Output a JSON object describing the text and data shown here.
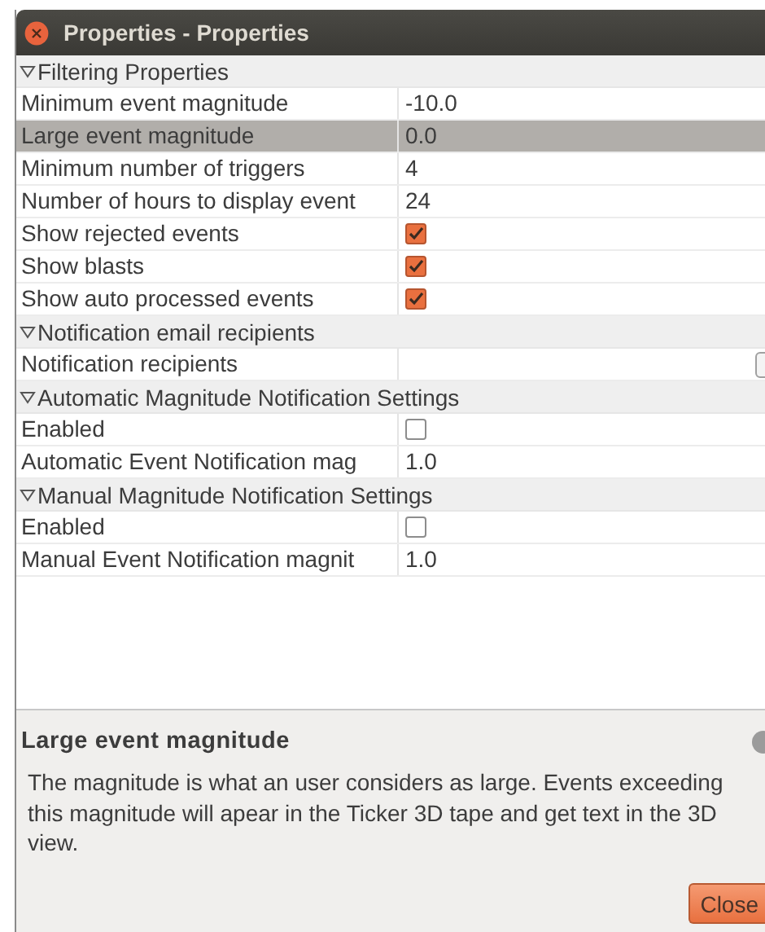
{
  "window": {
    "title": "Properties - Properties"
  },
  "groups": [
    {
      "title": "Filtering Properties",
      "expanded": true,
      "properties": [
        {
          "kind": "text",
          "name": "Minimum event magnitude",
          "value": "-10.0",
          "selected": false
        },
        {
          "kind": "text",
          "name": "Large event magnitude",
          "value": "0.0",
          "selected": true
        },
        {
          "kind": "text",
          "name": "Minimum number of triggers",
          "value": "4",
          "selected": false
        },
        {
          "kind": "text",
          "name": "Number of hours to display event",
          "value": "24",
          "selected": false
        },
        {
          "kind": "check",
          "name": "Show rejected events",
          "checked": true,
          "selected": false
        },
        {
          "kind": "check",
          "name": "Show blasts",
          "checked": true,
          "selected": false
        },
        {
          "kind": "check",
          "name": "Show auto processed events",
          "checked": true,
          "selected": false
        }
      ]
    },
    {
      "title": "Notification email recipients",
      "expanded": true,
      "properties": [
        {
          "kind": "button",
          "name": "Notification recipients",
          "selected": false
        }
      ]
    },
    {
      "title": "Automatic Magnitude Notification Settings",
      "expanded": true,
      "properties": [
        {
          "kind": "check",
          "name": "Enabled",
          "checked": false,
          "selected": false
        },
        {
          "kind": "text",
          "name": "Automatic Event Notification mag",
          "value": "1.0",
          "selected": false
        }
      ]
    },
    {
      "title": "Manual Magnitude Notification Settings",
      "expanded": true,
      "properties": [
        {
          "kind": "check",
          "name": "Enabled",
          "checked": false,
          "selected": false
        },
        {
          "kind": "text",
          "name": "Manual Event Notification magnit",
          "value": "1.0",
          "selected": false
        }
      ]
    }
  ],
  "description": {
    "title": "Large event magnitude",
    "text": "The magnitude is what an user considers as large. Events exceeding this magnitude will apear in the Ticker 3D tape and get text in the 3D view."
  },
  "buttons": [
    {
      "label": "Close"
    }
  ]
}
